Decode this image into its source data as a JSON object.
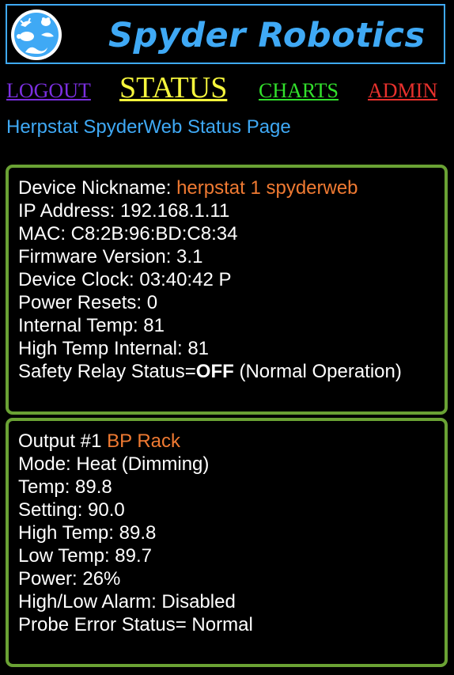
{
  "header": {
    "brand": "Spyder Robotics"
  },
  "nav": {
    "logout": "LOGOUT",
    "status": "STATUS",
    "charts": "CHARTS",
    "admin": "ADMIN"
  },
  "page_title": "Herpstat SpyderWeb Status Page",
  "device": {
    "nickname_label": "Device Nickname: ",
    "nickname_value": "herpstat 1 spyderweb",
    "ip": "IP Address: 192.168.1.11",
    "mac": "MAC: C8:2B:96:BD:C8:34",
    "firmware": "Firmware Version: 3.1",
    "clock": "Device Clock: 03:40:42 P",
    "power_resets": "Power Resets: 0",
    "internal_temp": "Internal Temp: 81",
    "high_temp_internal": "High Temp Internal: 81",
    "safety_label": "Safety Relay Status=",
    "safety_value": "OFF",
    "safety_note": " (Normal Operation)"
  },
  "output": {
    "label": "Output #1 ",
    "name": "BP Rack",
    "mode": "Mode: Heat (Dimming)",
    "temp": "Temp: 89.8",
    "setting": "Setting: 90.0",
    "high_temp": "High Temp: 89.8",
    "low_temp": "Low Temp: 89.7",
    "power": "Power: 26%",
    "alarm": "High/Low Alarm: Disabled",
    "probe_status": "Probe Error Status= Normal"
  },
  "colors": {
    "brand_blue": "#3fa9f5",
    "panel_border": "#6aa234",
    "accent_orange": "#f07a32",
    "logout": "#7b2fe0",
    "status": "#f5f53c",
    "charts": "#32e02c",
    "admin": "#e8312d"
  }
}
